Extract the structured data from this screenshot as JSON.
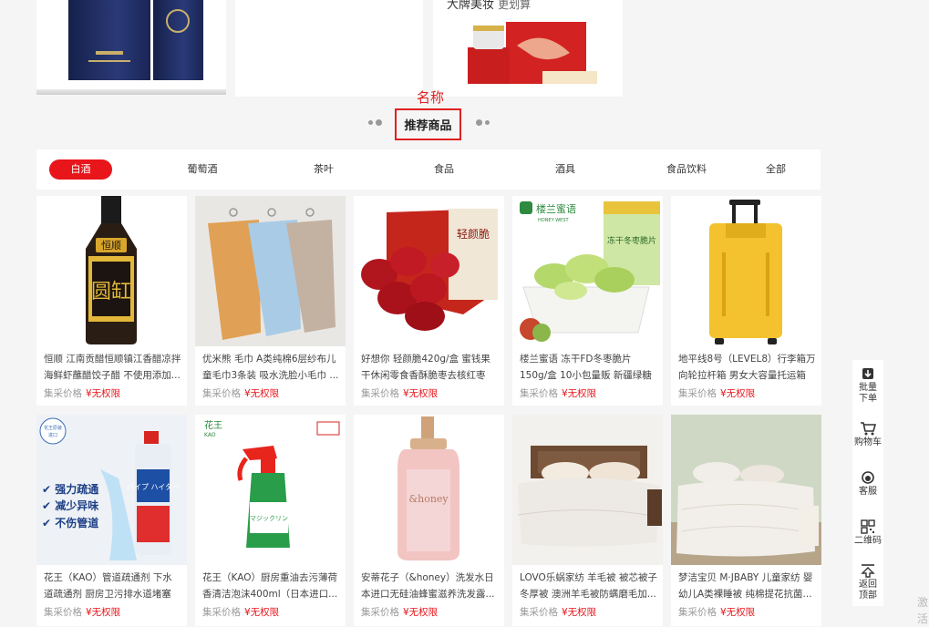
{
  "banner": {
    "title_main": "大牌美妆",
    "title_sub": "更划算"
  },
  "floor": {
    "annotation": "名称",
    "title": "推荐商品"
  },
  "tabs": [
    {
      "label": "白酒",
      "active": true
    },
    {
      "label": "葡萄酒"
    },
    {
      "label": "茶叶"
    },
    {
      "label": "食品"
    },
    {
      "label": "酒具"
    },
    {
      "label": "食品饮料"
    },
    {
      "label": "全部"
    }
  ],
  "price_label": "集采价格",
  "products": [
    {
      "name": "恒顺 江南贡醋恒顺镇江香醋凉拌海鲜虾蘸醋饺子醋 不使用添加...",
      "price": "¥无权限",
      "image": "soy-vinegar-bottle"
    },
    {
      "name": "优米熊 毛巾 A类纯棉6层纱布儿童毛巾3条装 吸水洗脸小毛巾 ...",
      "price": "¥无权限",
      "image": "towels"
    },
    {
      "name": "好想你 轻颜脆420g/盒 蜜钱果干休闲零食香酥脆枣去核红枣新...",
      "price": "¥无权限",
      "image": "red-dates"
    },
    {
      "name": "楼兰蜜语 冻干FD冬枣脆片150g/盒 10小包量贩 新疆绿糖心 酥...",
      "price": "¥无权限",
      "image": "dried-jujube"
    },
    {
      "name": "地平线8号（LEVEL8）行李箱万向轮拉杆箱 男女大容量托运箱2...",
      "price": "¥无权限",
      "image": "suitcase"
    },
    {
      "name": "花王（KAO）管道疏通剂 下水道疏通剂 厨房卫污排水道堵塞强...",
      "price": "¥无权限",
      "image": "pipe-cleaner"
    },
    {
      "name": "花王（KAO）厨房重油去污薄荷香清洁泡沫400ml（日本进口...",
      "price": "¥无权限",
      "image": "kitchen-spray"
    },
    {
      "name": "安蒂花子（&honey）洗发水日本进口无硅油蜂蜜滋养洗发露...",
      "price": "¥无权限",
      "image": "shampoo"
    },
    {
      "name": "LOVO乐蜗家纺 羊毛被 被芯被子冬厚被 澳洲羊毛被防螨磨毛加...",
      "price": "¥无权限",
      "image": "wool-quilt"
    },
    {
      "name": "梦洁宝贝 M·JBABY 儿童家纺 婴幼儿A类裸睡被 纯棉提花抗菌...",
      "price": "¥无权限",
      "image": "baby-quilt"
    }
  ],
  "pipe_cleaner_text": {
    "badge_top": "花王原装",
    "badge_bottom": "进口",
    "claims": [
      "✔ 强力疏通",
      "✔ 减少异味",
      "✔ 不伤管道"
    ],
    "brand": "パイプ ハイター"
  },
  "kitchen_spray_text": {
    "logo": "花王",
    "logo_sub": "KAO",
    "brand": "マジックリン"
  },
  "vinegar_text": {
    "label": "恒顺",
    "main": "圆缸"
  },
  "dates_text": {
    "box": "轻颜脆"
  },
  "jujube_text": {
    "brand": "楼兰蜜语",
    "brand_en": "HONEY WEST",
    "box": "冻干冬枣脆片"
  },
  "shampoo_text": {
    "logo": "&honey"
  },
  "sidebar": [
    {
      "label": "批量下单",
      "icon": "download-icon"
    },
    {
      "label": "购物车",
      "icon": "cart-icon"
    },
    {
      "label": "客服",
      "icon": "headset-icon"
    },
    {
      "label": "二维码",
      "icon": "qrcode-icon"
    },
    {
      "label": "返回顶部",
      "icon": "arrow-up-icon"
    }
  ],
  "watermark": "激活"
}
